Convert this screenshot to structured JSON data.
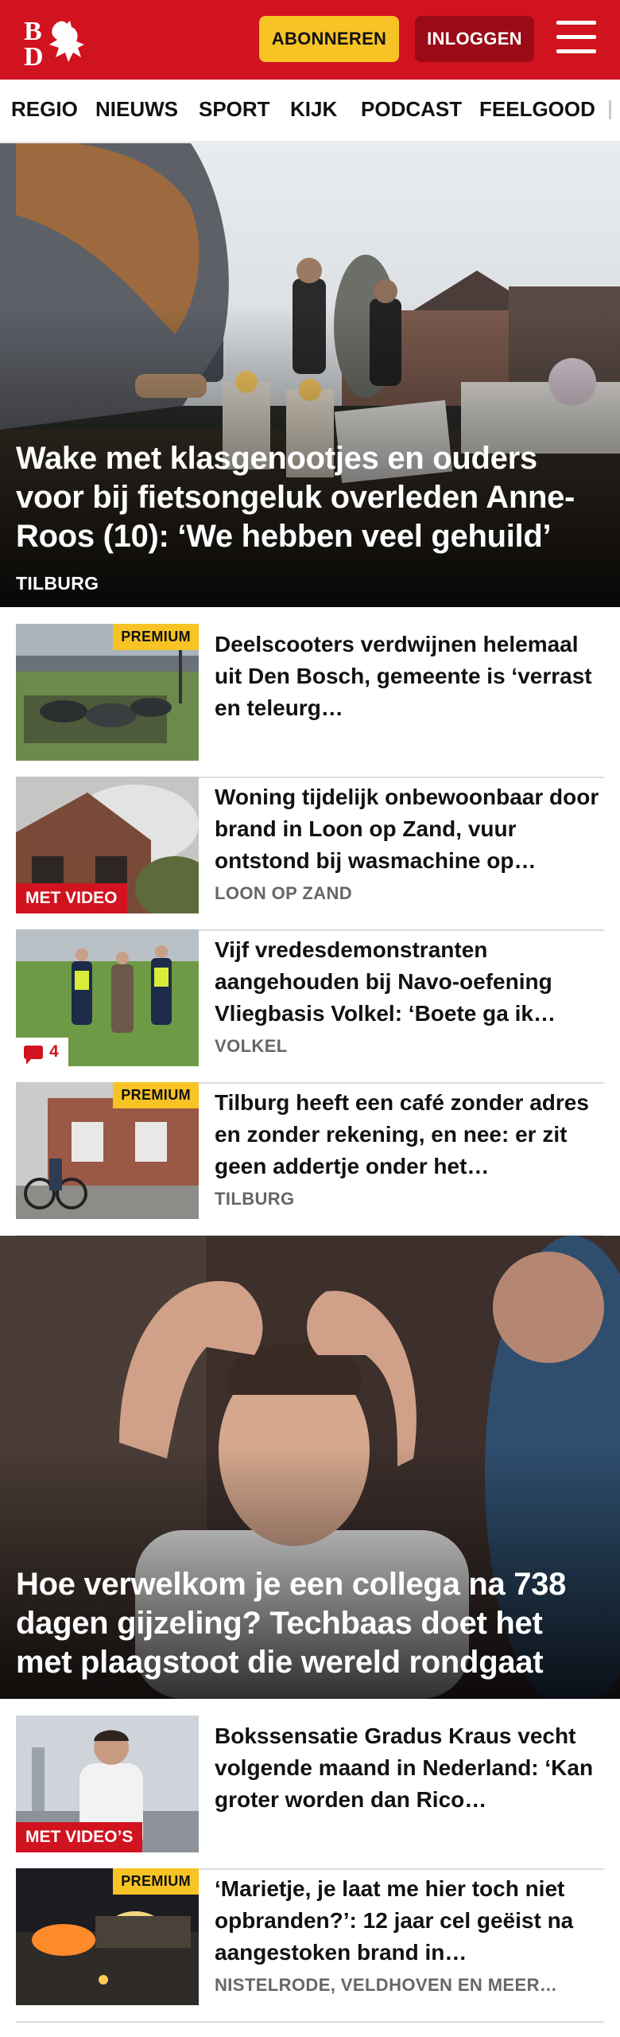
{
  "header": {
    "subscribe_label": "ABONNEREN",
    "login_label": "INLOGGEN",
    "brand_color": "#d0131f",
    "accent_color": "#f7c325"
  },
  "nav": {
    "items": [
      "REGIO",
      "NIEUWS",
      "SPORT",
      "KIJK",
      "PODCAST",
      "FEELGOOD"
    ]
  },
  "hero1": {
    "title": "Wake met klasgenootjes en ouders voor bij fietsongeluk overleden Anne-Roos (10): ‘We hebben veel gehuild’",
    "location": "TILBURG"
  },
  "articles": [
    {
      "title": "Deelscooters verdwijnen helemaal uit Den Bosch, gemeente is ‘verrast en teleurg…",
      "badge": "PREMIUM",
      "location": ""
    },
    {
      "title": "Woning tijdelijk onbewoonbaar door brand in Loon op Zand, vuur ontstond bij wasmachine op…",
      "badge": "MET VIDEO",
      "location": "LOON OP ZAND"
    },
    {
      "title": "Vijf vredesdemonstranten aangehouden bij Navo-oefening Vliegbasis Volkel: ‘Boete ga ik…",
      "comments": "4",
      "location": "VOLKEL"
    },
    {
      "title": "Tilburg heeft een café zonder adres en zonder rekening, en nee: er zit geen addertje onder het…",
      "badge": "PREMIUM",
      "location": "TILBURG"
    }
  ],
  "hero2": {
    "title": "Hoe verwelkom je een collega na 738 dagen gijzeling? Techbaas doet het met plaagstoot die wereld rondgaat"
  },
  "articles2": [
    {
      "title": "Bokssensatie Gradus Kraus vecht volgende maand in Nederland: ‘Kan groter worden dan Rico…",
      "badge": "MET VIDEO’S",
      "location": ""
    },
    {
      "title": "‘Marietje, je laat me hier toch niet opbranden?’: 12 jaar cel geëist na aangestoken brand in…",
      "badge": "PREMIUM",
      "location": "NISTELRODE, VELDHOVEN EN MEER…"
    }
  ]
}
